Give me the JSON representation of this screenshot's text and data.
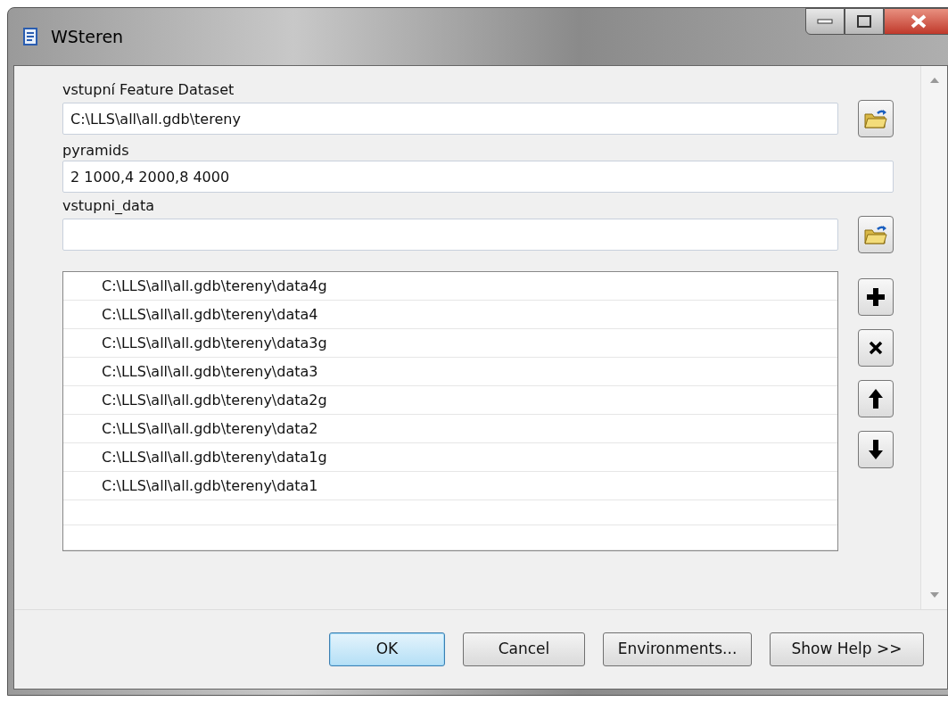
{
  "window": {
    "title": "WSteren"
  },
  "fields": [
    {
      "label": "vstupní Feature Dataset",
      "value": "C:\\LLS\\all\\all.gdb\\tereny",
      "kind": "browse"
    },
    {
      "label": "pyramids",
      "value": "2 1000,4 2000,8 4000",
      "kind": "text"
    },
    {
      "label": "vstupni_data",
      "kind": "browse"
    }
  ],
  "list": {
    "items": [
      "C:\\LLS\\all\\all.gdb\\tereny\\data4g",
      "C:\\LLS\\all\\all.gdb\\tereny\\data4",
      "C:\\LLS\\all\\all.gdb\\tereny\\data3g",
      "C:\\LLS\\all\\all.gdb\\tereny\\data3",
      "C:\\LLS\\all\\all.gdb\\tereny\\data2g",
      "C:\\LLS\\all\\all.gdb\\tereny\\data2",
      "C:\\LLS\\all\\all.gdb\\tereny\\data1g",
      "C:\\LLS\\all\\all.gdb\\tereny\\data1"
    ],
    "tools": [
      {
        "kind": "add"
      },
      {
        "kind": "remove"
      },
      {
        "kind": "up"
      },
      {
        "kind": "down"
      }
    ]
  },
  "buttons": [
    {
      "label": "OK",
      "default": true
    },
    {
      "label": "Cancel",
      "default": false
    },
    {
      "label": "Environments...",
      "default": false
    },
    {
      "label": "Show Help >>",
      "default": false
    }
  ]
}
